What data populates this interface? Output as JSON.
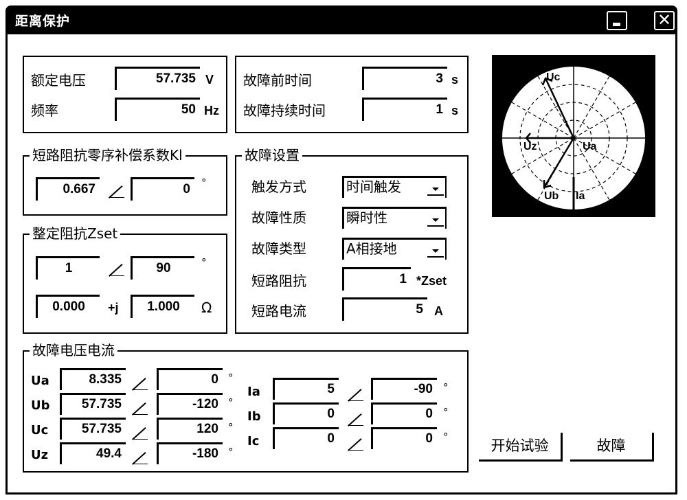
{
  "window": {
    "title": "距离保护",
    "minimize_icon": "minimize-icon",
    "close_icon": "close-icon",
    "close_glyph": "✕"
  },
  "rated": {
    "voltage_label": "额定电压",
    "voltage_value": "57.735",
    "voltage_unit": "V",
    "freq_label": "频率",
    "freq_value": "50",
    "freq_unit": "Hz"
  },
  "timing": {
    "pre_fault_label": "故障前时间",
    "pre_fault_value": "3",
    "pre_fault_unit": "s",
    "duration_label": "故障持续时间",
    "duration_value": "1",
    "duration_unit": "s"
  },
  "kl": {
    "title": "短路阻抗零序补偿系数Kl",
    "magnitude": "0.667",
    "angle": "0",
    "deg": "°"
  },
  "zset": {
    "title": "整定阻抗Zset",
    "magnitude": "1",
    "angle": "90",
    "deg": "°",
    "real": "0.000",
    "j_label": "+j",
    "imag": "1.000",
    "ohm": "Ω"
  },
  "fault_settings": {
    "title": "故障设置",
    "trigger_label": "触发方式",
    "trigger_value": "时间触发",
    "nature_label": "故障性质",
    "nature_value": "瞬时性",
    "type_label": "故障类型",
    "type_value": "A相接地",
    "impedance_label": "短路阻抗",
    "impedance_value": "1",
    "impedance_unit": "*Zset",
    "current_label": "短路电流",
    "current_value": "5",
    "current_unit": "A"
  },
  "fault_vi": {
    "title": "故障电压电流",
    "deg": "°",
    "voltages": [
      {
        "name": "Ua",
        "mag": "8.335",
        "angle": "0"
      },
      {
        "name": "Ub",
        "mag": "57.735",
        "angle": "-120"
      },
      {
        "name": "Uc",
        "mag": "57.735",
        "angle": "120"
      },
      {
        "name": "Uz",
        "mag": "49.4",
        "angle": "-180"
      }
    ],
    "currents": [
      {
        "name": "Ia",
        "mag": "5",
        "angle": "-90"
      },
      {
        "name": "Ib",
        "mag": "0",
        "angle": "0"
      },
      {
        "name": "Ic",
        "mag": "0",
        "angle": "0"
      }
    ]
  },
  "phasor": {
    "labels": {
      "uc": "Uc",
      "uz": "Uz",
      "ua": "Ua",
      "ub": "Ub",
      "ia": "Ia"
    }
  },
  "buttons": {
    "start": "开始试验",
    "fault": "故障"
  }
}
